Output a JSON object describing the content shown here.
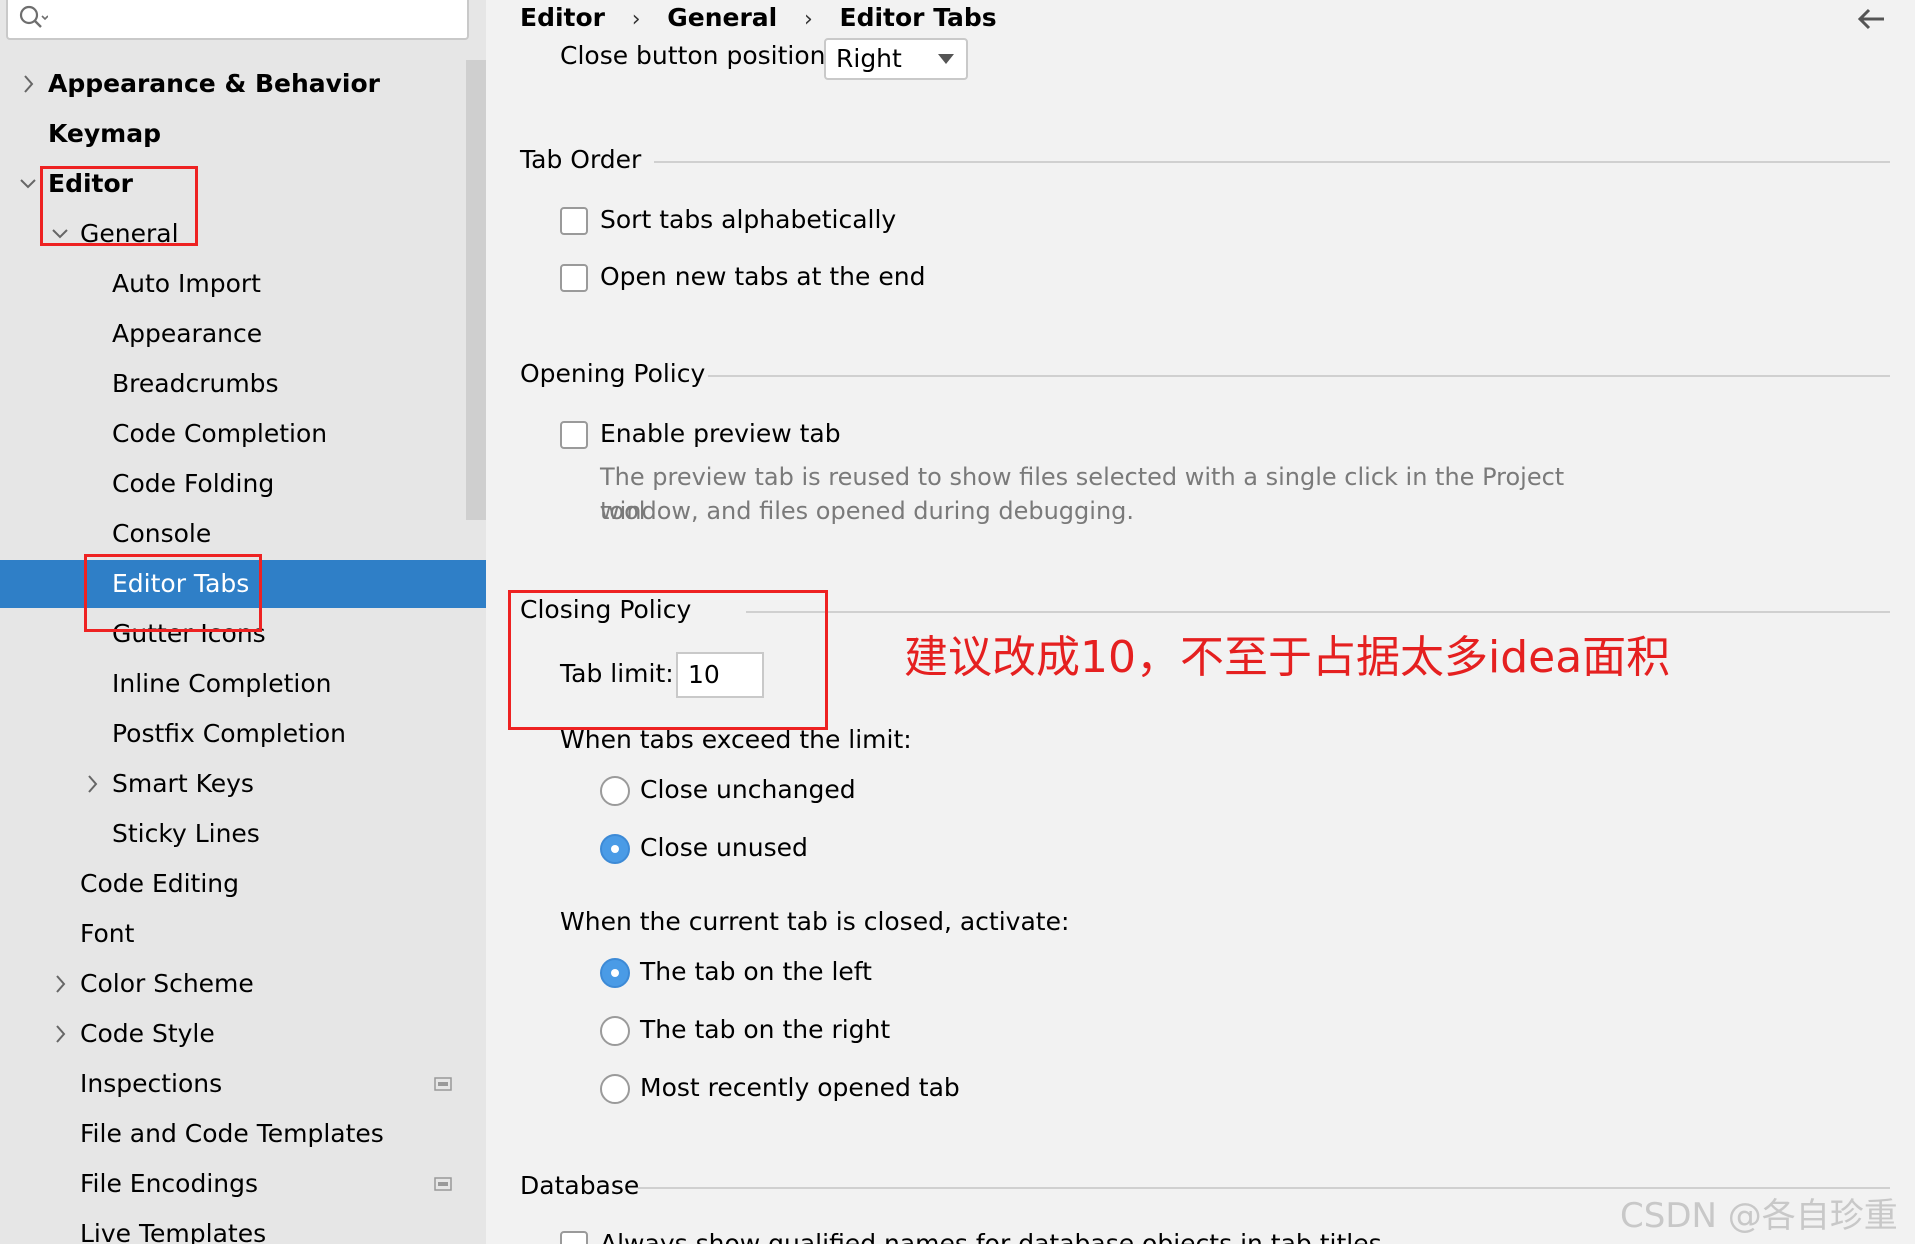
{
  "search": {
    "value": ""
  },
  "sidebar": {
    "items": [
      {
        "label": "Appearance & Behavior",
        "chevron": "right"
      },
      {
        "label": "Keymap"
      },
      {
        "label": "Editor",
        "chevron": "down"
      },
      {
        "label": "General",
        "chevron": "down"
      },
      {
        "label": "Auto Import"
      },
      {
        "label": "Appearance"
      },
      {
        "label": "Breadcrumbs"
      },
      {
        "label": "Code Completion"
      },
      {
        "label": "Code Folding"
      },
      {
        "label": "Console"
      },
      {
        "label": "Editor Tabs",
        "selected": true
      },
      {
        "label": "Gutter Icons"
      },
      {
        "label": "Inline Completion"
      },
      {
        "label": "Postfix Completion"
      },
      {
        "label": "Smart Keys",
        "chevron": "right"
      },
      {
        "label": "Sticky Lines"
      },
      {
        "label": "Code Editing"
      },
      {
        "label": "Font"
      },
      {
        "label": "Color Scheme",
        "chevron": "right"
      },
      {
        "label": "Code Style",
        "chevron": "right"
      },
      {
        "label": "Inspections",
        "icon": "project-scope-icon"
      },
      {
        "label": "File and Code Templates"
      },
      {
        "label": "File Encodings",
        "icon": "project-scope-icon"
      },
      {
        "label": "Live Templates"
      }
    ]
  },
  "breadcrumb": {
    "items": [
      "Editor",
      "General",
      "Editor Tabs"
    ],
    "separator": "›"
  },
  "close_button": {
    "label": "Close button position:",
    "value": "Right"
  },
  "tab_order": {
    "title": "Tab Order",
    "sort_alpha": "Sort tabs alphabetically",
    "open_at_end": "Open new tabs at the end"
  },
  "opening_policy": {
    "title": "Opening Policy",
    "preview_tab": "Enable preview tab",
    "hint_line1": "The preview tab is reused to show files selected with a single click in the Project tool",
    "hint_line2": "window, and files opened during debugging."
  },
  "closing_policy": {
    "title": "Closing Policy",
    "tab_limit_label": "Tab limit:",
    "tab_limit_value": "10",
    "exceed_label": "When tabs exceed the limit:",
    "close_unchanged": "Close unchanged",
    "close_unused": "Close unused",
    "activate_label": "When the current tab is closed, activate:",
    "tab_left": "The tab on the left",
    "tab_right": "The tab on the right",
    "most_recent": "Most recently opened tab"
  },
  "database": {
    "title": "Database",
    "qualified_names": "Always show qualified names for database objects in tab titles"
  },
  "annotation": {
    "note": "建议改成10，不至于占据太多idea面积",
    "color": "#e52020"
  },
  "watermark": "CSDN @各自珍重",
  "colors": {
    "selection": "#2f7fc7",
    "radio_on": "#4a9be6",
    "annotation": "#e22222"
  }
}
